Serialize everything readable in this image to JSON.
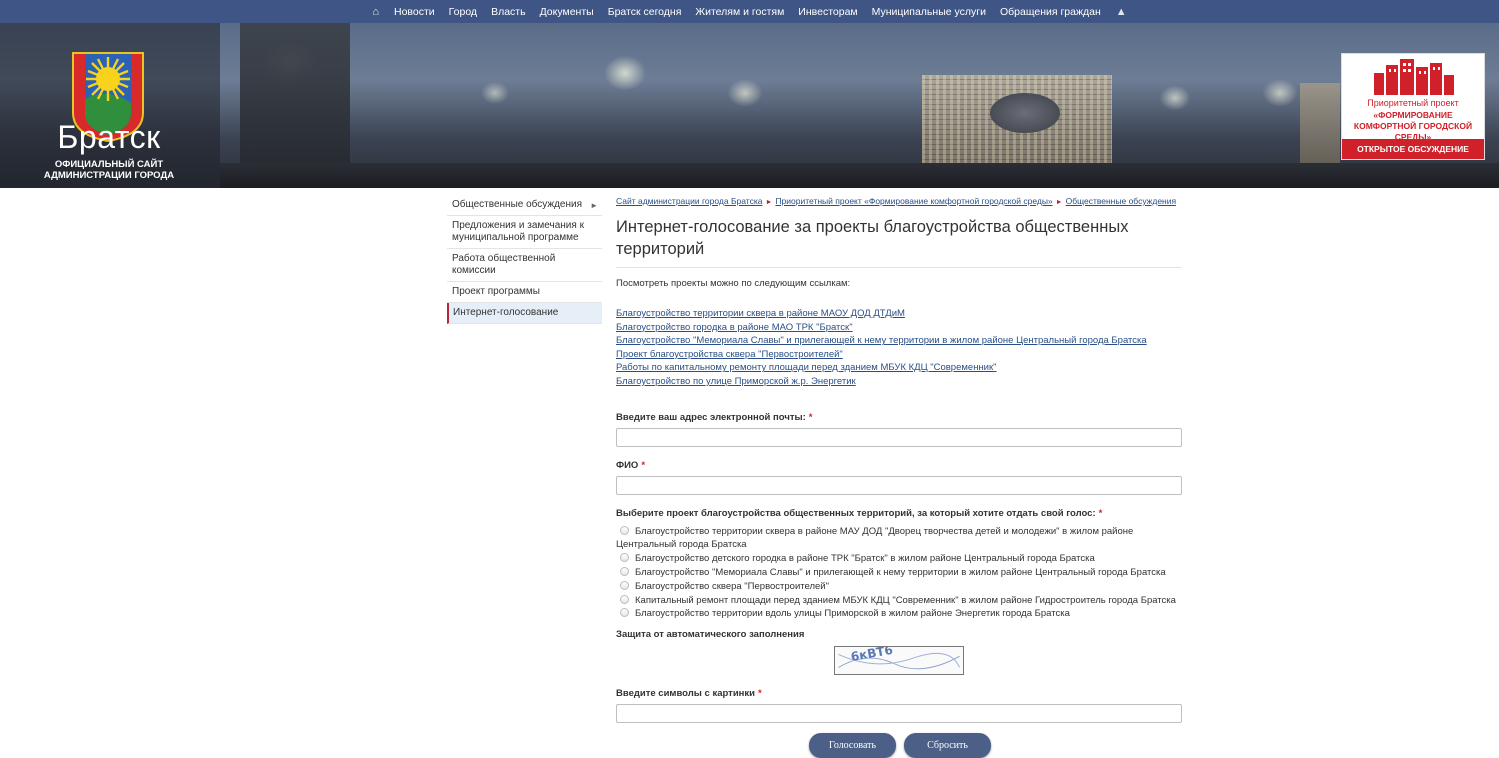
{
  "top_nav": {
    "home_icon": "home-icon",
    "items": [
      "Новости",
      "Город",
      "Власть",
      "Документы",
      "Братск сегодня",
      "Жителям и гостям",
      "Инвесторам",
      "Муниципальные услуги",
      "Обращения граждан"
    ],
    "sitemap_icon": "sitemap-icon"
  },
  "header": {
    "city_name": "Братск",
    "subtitle": "ОФИЦИАЛЬНЫЙ САЙТ АДМИНИСТРАЦИИ ГОРОДА",
    "promo": {
      "line1": "Приоритетный проект",
      "line2": "«ФОРМИРОВАНИЕ КОМФОРТНОЙ ГОРОДСКОЙ СРЕДЫ»",
      "footer": "ОТКРЫТОЕ ОБСУЖДЕНИЕ"
    }
  },
  "sidebar": {
    "items": [
      {
        "label": "Общественные обсуждения",
        "arrow": "►"
      },
      {
        "label": "Предложения и замечания к муниципальной программе"
      },
      {
        "label": "Работа общественной комиссии"
      },
      {
        "label": "Проект программы"
      },
      {
        "label": "Интернет-голосование"
      }
    ]
  },
  "breadcrumb": {
    "items": [
      "Сайт администрации города Братска",
      "Приоритетный проект «Формирование комфортной городской среды»",
      "Общественные обсуждения"
    ],
    "separator": "►"
  },
  "main": {
    "title": "Интернет-голосование за проекты благоустройства общественных территорий",
    "intro": "Посмотреть проекты можно по следующим ссылкам:",
    "links": [
      "Благоустройство территории сквера в районе МАОУ ДОД ДТДиМ",
      "Благоустройство городка в районе МАО ТРК \"Братск\"",
      "Благоустройство \"Мемориала Славы\" и прилегающей к нему территории в жилом районе Центральный города Братска",
      "Проект благоустройства сквера \"Первостроителей\"",
      "Работы по капитальному ремонту площади перед зданием МБУК КДЦ \"Современник\"",
      "Благоустройство по улице Приморской ж.р. Энергетик"
    ]
  },
  "form": {
    "email_label": "Введите ваш адрес электронной почты:",
    "fio_label": "ФИО",
    "required_mark": "*",
    "choice_label": "Выберите проект благоустройства общественных территорий, за который хотите отдать свой голос:",
    "options": [
      "Благоустройство территории сквера в районе МАУ ДОД \"Дворец творчества детей и молодежи\" в жилом районе Центральный города Братска",
      "Благоустройство детского городка в районе ТРК \"Братск\" в жилом районе Центральный города Братска",
      "Благоустройство \"Мемориала Славы\" и прилегающей к нему территории в жилом районе Центральный города Братска",
      "Благоустройство сквера \"Первостроителей\"",
      "Капитальный ремонт площади перед зданием МБУК КДЦ \"Современник\" в жилом районе Гидростроитель города Братска",
      "Благоустройство территории вдоль улицы Приморской в жилом районе Энергетик города Братска"
    ],
    "captcha_label": "Защита от автоматического заполнения",
    "captcha_text": "6кВТ6",
    "captcha_input_label": "Введите символы с картинки",
    "submit_label": "Голосовать",
    "reset_label": "Сбросить"
  }
}
